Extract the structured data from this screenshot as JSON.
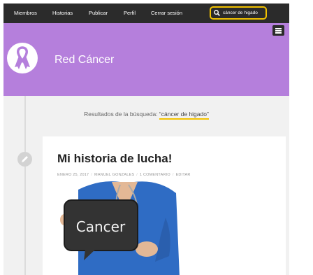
{
  "nav": {
    "items": [
      "Miembros",
      "Historias",
      "Publicar",
      "Perfil",
      "Cerrar sesión"
    ],
    "search_value": "cáncer de higado"
  },
  "site": {
    "title": "Red Cáncer"
  },
  "search_results": {
    "prefix": "Resultados de la búsqueda: ",
    "query": "“cáncer de higado”"
  },
  "post": {
    "title": "Mi historia de lucha!",
    "date": "ENERO 25, 2017",
    "author": "MANUEL GONZALES",
    "comments": "1 COMENTARIO",
    "edit": "EDITAR",
    "image_sign_text": "Cancer"
  },
  "colors": {
    "header": "#b57fdc",
    "nav": "#2b2b2b",
    "highlight": "#f2c200",
    "background": "#f1f1f1"
  }
}
